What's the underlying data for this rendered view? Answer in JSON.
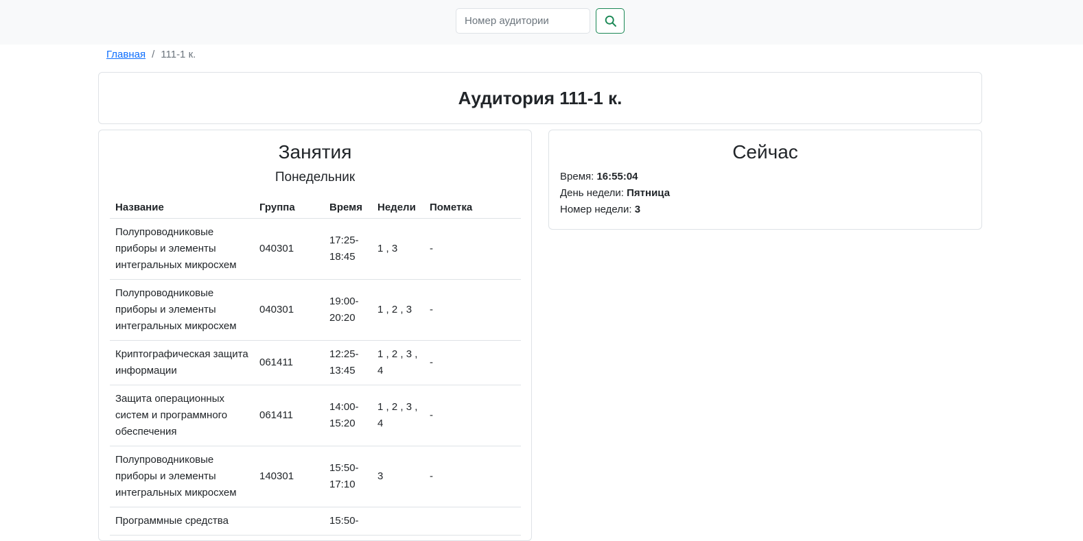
{
  "search": {
    "placeholder": "Номер аудитории",
    "value": ""
  },
  "icons": {
    "search_button": "search-icon"
  },
  "colors": {
    "accent": "#198754",
    "link": "#0d6efd",
    "topbar_bg": "#f8f9fa",
    "border": "#dee2e6"
  },
  "breadcrumb": {
    "home": "Главная",
    "separator": "/",
    "current": "111-1 к."
  },
  "page_title": "Аудитория 111-1 к.",
  "lessons": {
    "heading": "Занятия",
    "day": "Понедельник",
    "columns": [
      "Название",
      "Группа",
      "Время",
      "Недели",
      "Пометка"
    ],
    "rows": [
      {
        "name": "Полупроводниковые приборы и элементы интегральных микросхем",
        "group": "040301",
        "time": "17:25-18:45",
        "weeks": "1 , 3",
        "note": "-"
      },
      {
        "name": "Полупроводниковые приборы и элементы интегральных микросхем",
        "group": "040301",
        "time": "19:00-20:20",
        "weeks": "1 , 2 , 3",
        "note": "-"
      },
      {
        "name": "Криптографическая защита информации",
        "group": "061411",
        "time": "12:25-13:45",
        "weeks": "1 , 2 , 3 , 4",
        "note": "-"
      },
      {
        "name": "Защита операционных систем и программного обеспечения",
        "group": "061411",
        "time": "14:00-15:20",
        "weeks": "1 , 2 , 3 , 4",
        "note": "-"
      },
      {
        "name": "Полупроводниковые приборы и элементы интегральных микросхем",
        "group": "140301",
        "time": "15:50-17:10",
        "weeks": "3",
        "note": "-"
      },
      {
        "name": "Программные средства",
        "group": "",
        "time": "15:50-",
        "weeks": "",
        "note": ""
      }
    ]
  },
  "now": {
    "heading": "Сейчас",
    "time_label": "Время:",
    "time_value": "16:55:04",
    "weekday_label": "День недели:",
    "weekday_value": "Пятница",
    "week_label": "Номер недели:",
    "week_value": "3"
  }
}
